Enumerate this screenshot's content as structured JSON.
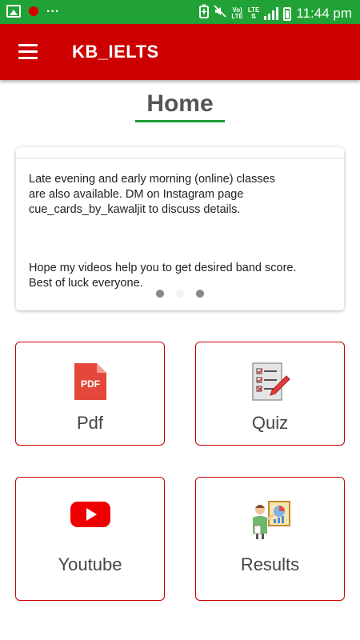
{
  "status_bar": {
    "time": "11:44 pm",
    "more": "...",
    "network": {
      "top": "Vo)",
      "bottom": "LTE"
    },
    "lte": "LTE",
    "icons": [
      "gallery-icon",
      "notification-dot-icon",
      "battery-saver-icon",
      "mute-icon",
      "wifi-icon",
      "signal-icon",
      "battery-icon"
    ]
  },
  "app_bar": {
    "title": "KB_IELTS",
    "menu_icon": "menu-icon"
  },
  "page": {
    "title": "Home"
  },
  "info_card": {
    "paragraph_1": "Late evening and early morning (online) classes\nare also available.  DM on Instagram page\ncue_cards_by_kawaljit to discuss details.",
    "paragraph_2": "Hope my videos help you to get desired band score.\nBest of luck everyone.",
    "carousel": {
      "total": 3,
      "active_index": 2
    }
  },
  "tiles": [
    {
      "label": "Pdf",
      "icon": "pdf-icon"
    },
    {
      "label": "Quiz",
      "icon": "quiz-icon"
    },
    {
      "label": "Youtube",
      "icon": "youtube-icon"
    },
    {
      "label": "Results",
      "icon": "results-icon"
    }
  ],
  "colors": {
    "status_bar": "#21a236",
    "app_bar": "#cc0000",
    "title_underline": "#1e9b34",
    "tile_border": "#cc0000"
  }
}
